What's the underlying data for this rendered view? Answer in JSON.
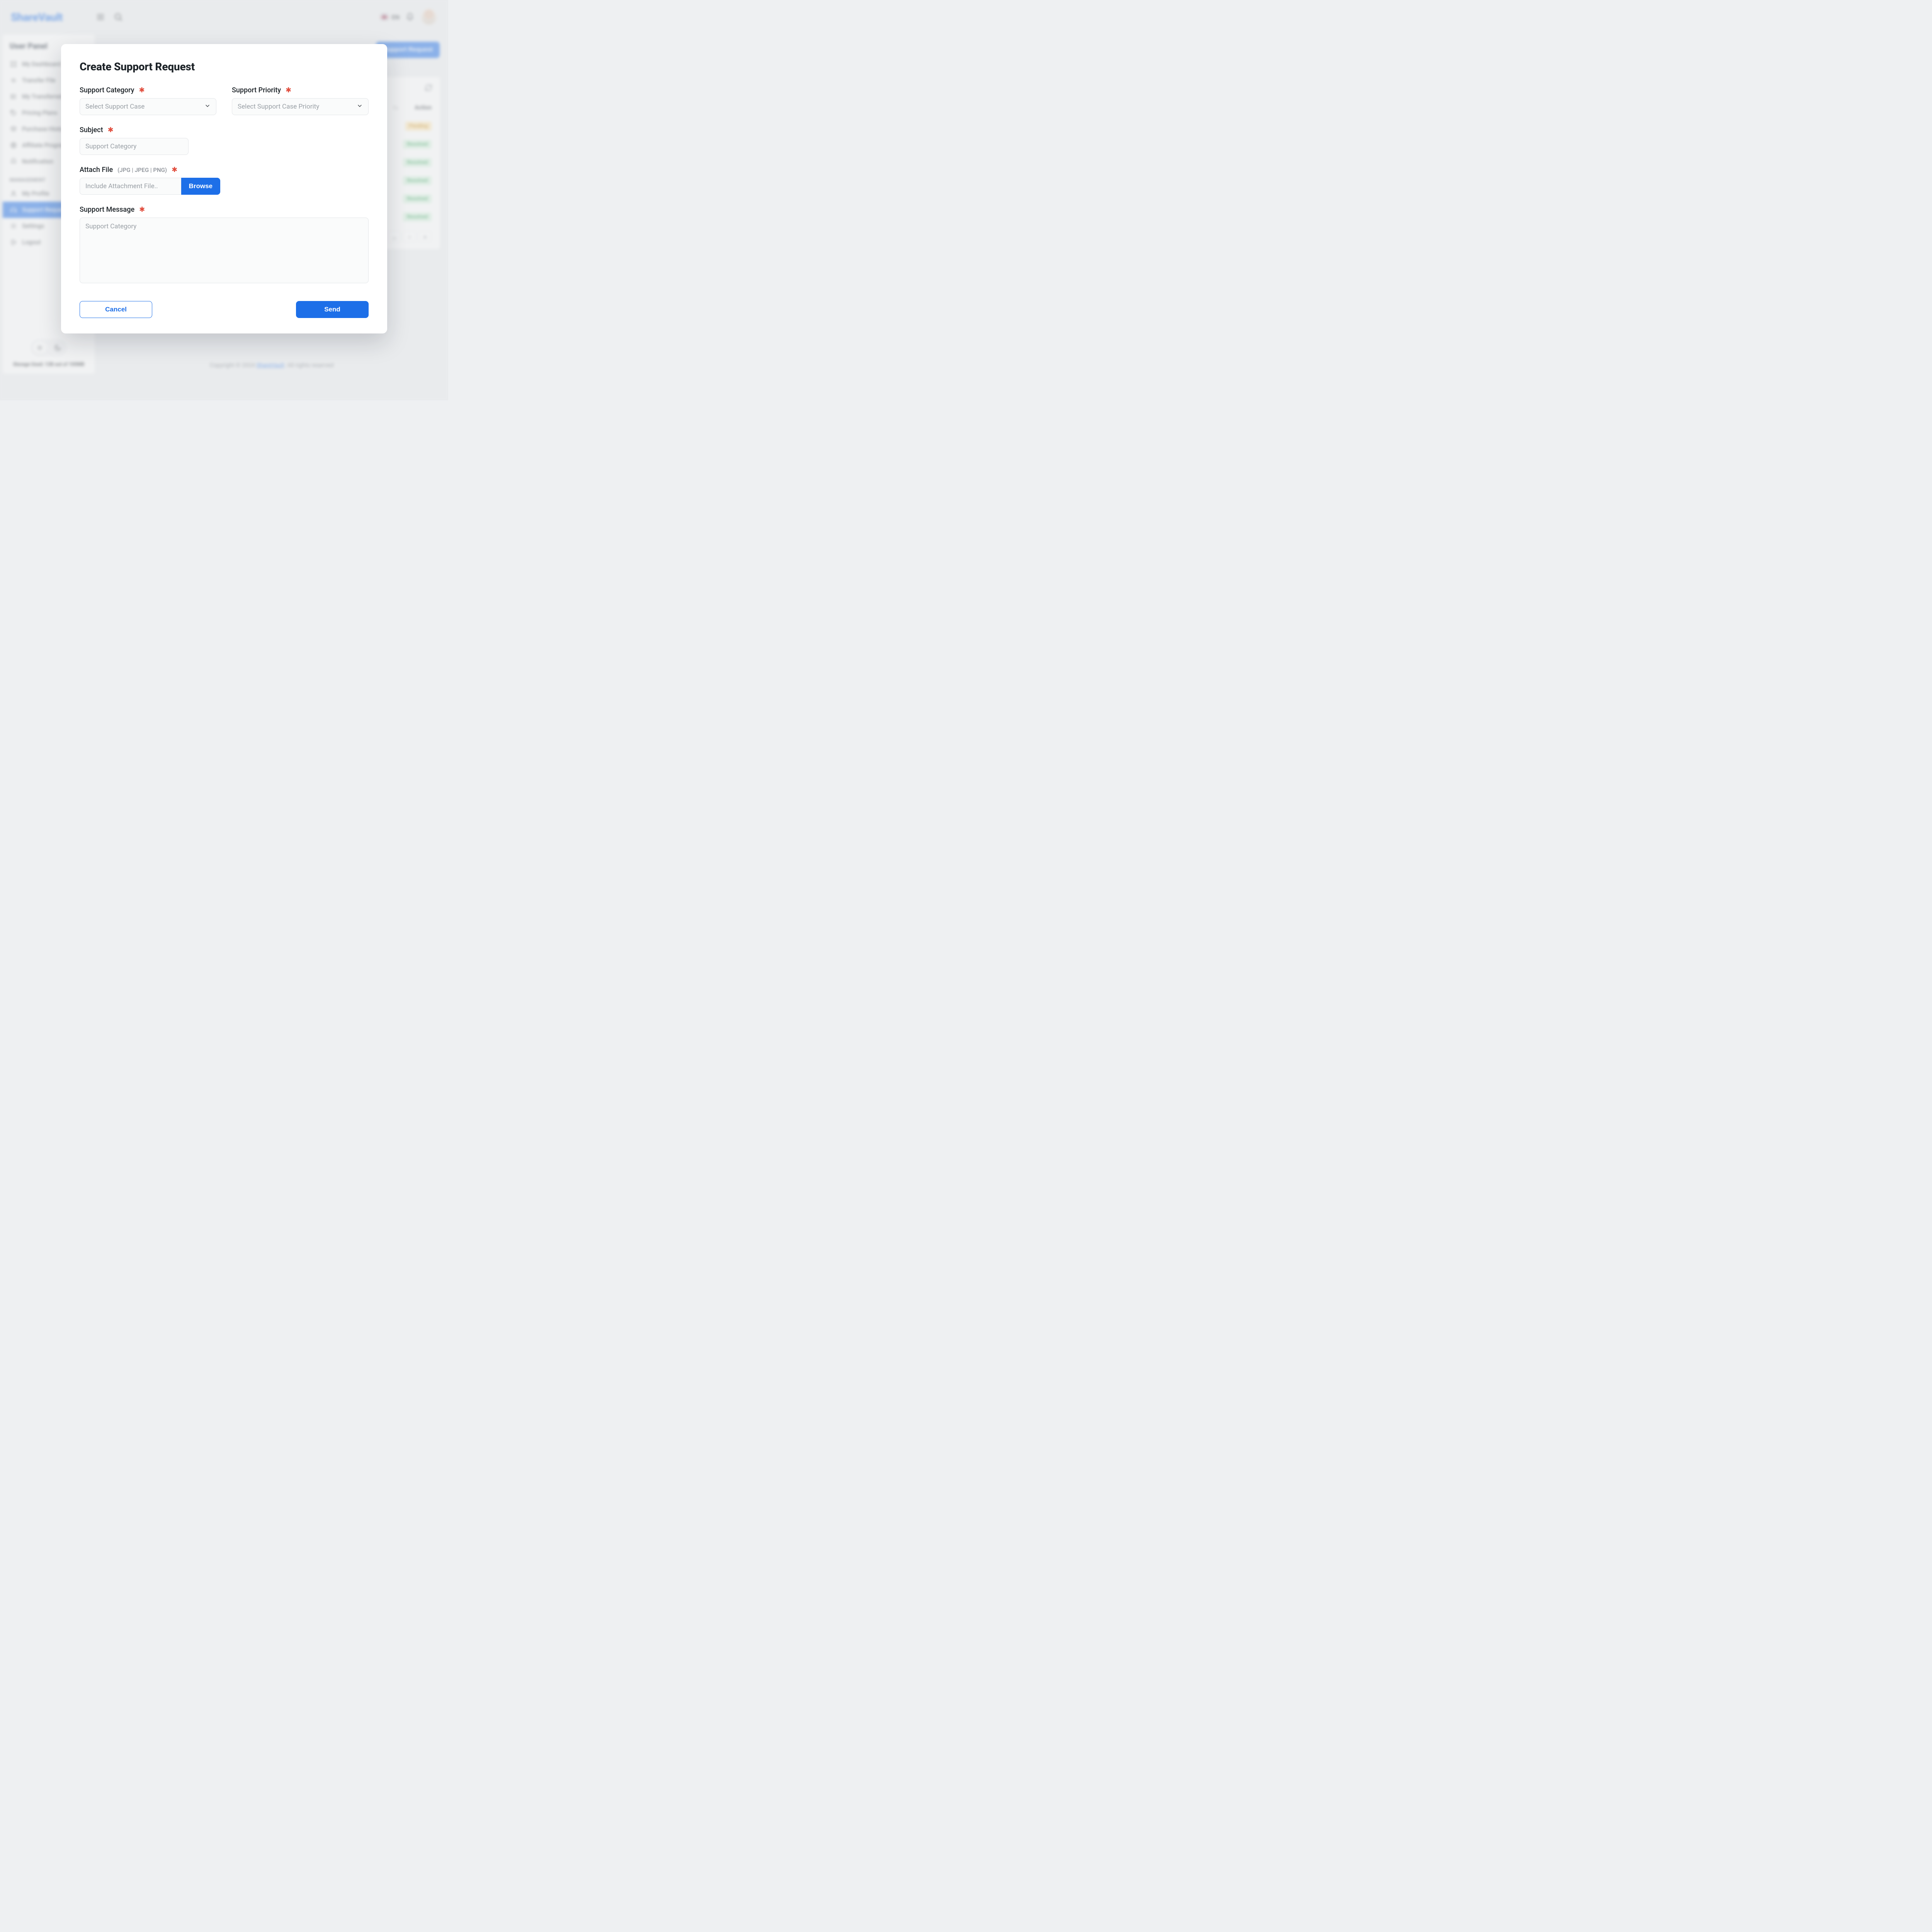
{
  "brand": "ShareVault",
  "header": {
    "lang": "EN"
  },
  "sidebar": {
    "title": "User Panel",
    "items": [
      {
        "label": "My Dashboard"
      },
      {
        "label": "Transfer File"
      },
      {
        "label": "My Transferred"
      },
      {
        "label": "Pricing Plans"
      },
      {
        "label": "Purchase History"
      },
      {
        "label": "Affiliate Program"
      },
      {
        "label": "Notification"
      }
    ],
    "section": "MANAGEMENT",
    "mgmt": [
      {
        "label": "My Profile"
      },
      {
        "label": "Support Request"
      },
      {
        "label": "Settings"
      },
      {
        "label": "Logout"
      }
    ],
    "storage": "Storage Used: 12B out of 100MB"
  },
  "main": {
    "cta": "Support Request",
    "columns": {
      "sort": "↑↓",
      "action": "Action"
    },
    "statuses": [
      "Pending",
      "Resolved",
      "Resolved",
      "Resolved",
      "Resolved",
      "Resolved"
    ],
    "pager": [
      "…",
      "›",
      "»"
    ]
  },
  "modal": {
    "title": "Create Support Request",
    "category_label": "Support Category",
    "category_placeholder": "Select Support Case",
    "priority_label": "Support Priority",
    "priority_placeholder": "Select Support Case Priority",
    "subject_label": "Subject",
    "subject_placeholder": "Support Category",
    "attach_label": "Attach File",
    "attach_hint": "(JPG | JPEG | PNG)",
    "attach_placeholder": "Include Attachment File..",
    "browse": "Browse",
    "message_label": "Support Message",
    "message_placeholder": "Support Category",
    "cancel": "Cancel",
    "send": "Send"
  },
  "footer": {
    "prefix": "Copyright © 2024 ",
    "link": "ShareVault",
    "suffix": ". All rights reserved"
  }
}
